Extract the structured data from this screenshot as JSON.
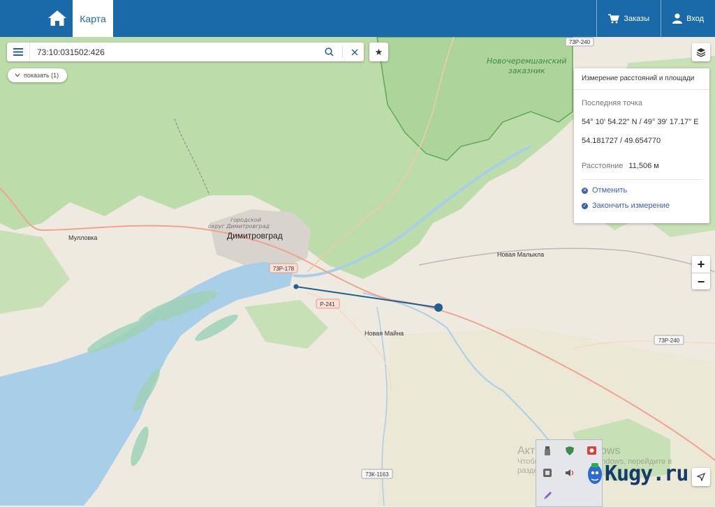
{
  "header": {
    "tab_map": "Карта",
    "orders": "Заказы",
    "login": "Вход"
  },
  "search": {
    "value": "73:10:031502:426"
  },
  "show_button": "показать (1)",
  "map_labels": {
    "reserve": [
      "Новочеремшанский",
      "заказник"
    ],
    "road_73p240_top": "73Р-240",
    "road_73p240_right": "73Р-240",
    "road_73p178": "73Р-178",
    "road_p241": "Р-241",
    "road_73k1163": "73К-1163",
    "city_district": [
      "городской",
      "округ Димитровград"
    ],
    "city": "Димитровград",
    "mullovka": "Мулловка",
    "novaya_malykla": "Новая Малыкла",
    "novaya_mayna": "Новая Майна"
  },
  "measure_panel": {
    "title": "Измерение расстояний и площади",
    "last_point_label": "Последняя точка",
    "dms": "54° 10' 54.22\" N / 49° 39' 17.17\" E",
    "decimal": "54.181727 / 49.654770",
    "distance_label": "Расстояние",
    "distance_value": "11,506 м",
    "cancel": "Отменить",
    "finish": "Закончить измерение"
  },
  "zoom": {
    "in": "+",
    "out": "−"
  },
  "windows_activation": {
    "line1": "Активация Windows",
    "line2": "Чтобы активировать Windows, перейдите в",
    "line3": "раздел \"Параметры\"."
  },
  "watermark": "Kugy.ru",
  "colors": {
    "header": "#1a6aaa",
    "forest": "#bcdca9",
    "water": "#a9cfe8",
    "measure_line": "#1f5f96",
    "link": "#3b5fb0"
  },
  "icons": [
    "home-icon",
    "cart-icon",
    "user-icon",
    "menu-icon",
    "search-icon",
    "clear-icon",
    "star-icon",
    "chevron-down-icon",
    "layers-icon",
    "cancel-icon",
    "check-icon",
    "locate-icon"
  ]
}
